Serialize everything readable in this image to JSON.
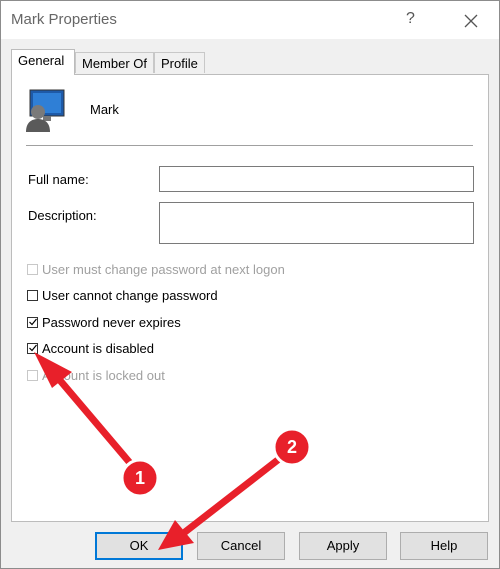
{
  "window": {
    "title": "Mark Properties",
    "help_glyph": "?",
    "close_icon": "close-icon"
  },
  "tabs": [
    {
      "label": "General",
      "active": true
    },
    {
      "label": "Member Of",
      "active": false
    },
    {
      "label": "Profile",
      "active": false
    }
  ],
  "user": {
    "name": "Mark",
    "icon": "user-monitor-icon"
  },
  "form": {
    "full_name_label": "Full name:",
    "full_name_value": "",
    "description_label": "Description:",
    "description_value": ""
  },
  "checkboxes": [
    {
      "label": "User must change password at next logon",
      "checked": false,
      "enabled": false
    },
    {
      "label": "User cannot change password",
      "checked": false,
      "enabled": true
    },
    {
      "label": "Password never expires",
      "checked": true,
      "enabled": true
    },
    {
      "label": "Account is disabled",
      "checked": true,
      "enabled": true
    },
    {
      "label": "Account is locked out",
      "checked": false,
      "enabled": false
    }
  ],
  "buttons": {
    "ok": "OK",
    "cancel": "Cancel",
    "apply": "Apply",
    "help": "Help"
  },
  "annotations": [
    {
      "number": "1",
      "color": "#e8202a"
    },
    {
      "number": "2",
      "color": "#e8202a"
    }
  ]
}
